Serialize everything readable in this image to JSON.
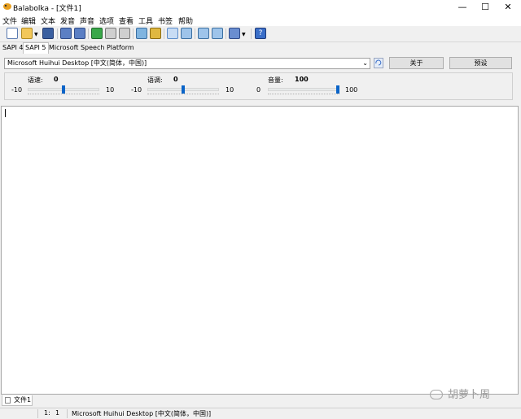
{
  "window": {
    "title": "Balabolka - [文件1]",
    "controls": [
      "—",
      "☐",
      "✕"
    ]
  },
  "menu": [
    "文件",
    "编辑",
    "文本",
    "发音",
    "声音",
    "选项",
    "查看",
    "工具",
    "书签",
    "帮助"
  ],
  "toolbar": {
    "icons": [
      "new-icon",
      "open-icon",
      "save-icon",
      "print-icon",
      "print-preview-icon",
      "play-icon",
      "pause-icon",
      "stop-icon",
      "save-audio-icon",
      "convert-icon",
      "settings-icon",
      "clipboard-icon",
      "split-icon",
      "merge-icon",
      "batch-icon",
      "help-icon"
    ]
  },
  "api_tabs": [
    "SAPI 4",
    "SAPI 5",
    "Microsoft Speech Platform"
  ],
  "voice": {
    "selected": "Microsoft Huihui Desktop [中文(简体，中国)]",
    "about_label": "关于",
    "preset_label": "预设"
  },
  "sliders": {
    "rate": {
      "label": "语速:",
      "value": "0",
      "min": "-10",
      "max": "10",
      "position": 0.5
    },
    "pitch": {
      "label": "语调:",
      "value": "0",
      "min": "-10",
      "max": "10",
      "position": 0.5
    },
    "volume": {
      "label": "音量:",
      "value": "100",
      "min": "0",
      "max": "100",
      "position": 1.0
    }
  },
  "document_tab": "文件1",
  "status": {
    "line": "1:",
    "col": "1",
    "voice": "Microsoft Huihui Desktop [中文(简体，中国)]"
  },
  "watermark": "胡萝卜周",
  "colors": {
    "accent": "#0a64c8",
    "background": "#f0f0f0"
  }
}
